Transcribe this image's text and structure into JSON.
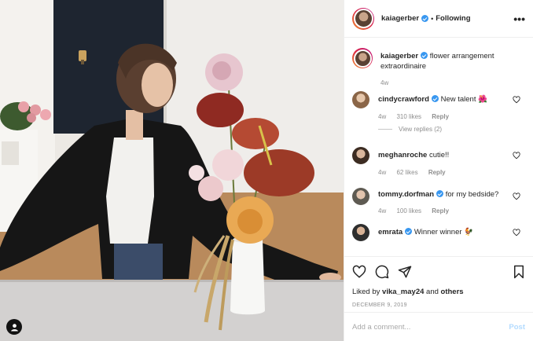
{
  "post": {
    "author": "kaiagerber",
    "separator": "•",
    "following_label": "Following",
    "more_label": "•••",
    "caption": "flower arrangement extraordinaire",
    "caption_age": "4w"
  },
  "comments": [
    {
      "user": "cindycrawford",
      "text": "New talent 🌺",
      "age": "4w",
      "likes": "310 likes",
      "reply": "Reply",
      "view_replies": "View replies (2)",
      "avatar_color": "#b48a6a"
    },
    {
      "user": "meghanroche",
      "text": "cutie!!",
      "age": "4w",
      "likes": "62 likes",
      "reply": "Reply",
      "avatar_color": "#4a3a30"
    },
    {
      "user": "tommy.dorfman",
      "text": "for my bedside?",
      "age": "4w",
      "likes": "100 likes",
      "reply": "Reply",
      "avatar_color": "#6d6a62"
    },
    {
      "user": "emrata",
      "text": "Winner winner 🐓",
      "avatar_color": "#3b3b3b"
    }
  ],
  "likes_summary": {
    "prefix": "Liked by ",
    "user": "vika_may24",
    "middle": " and ",
    "others": "others"
  },
  "date": "DECEMBER 9, 2019",
  "add_comment": {
    "placeholder": "Add a comment...",
    "post_label": "Post"
  },
  "colors": {
    "verified": "#3897f0",
    "link_blue": "#b3dbff",
    "muted": "#8e8e8e"
  }
}
